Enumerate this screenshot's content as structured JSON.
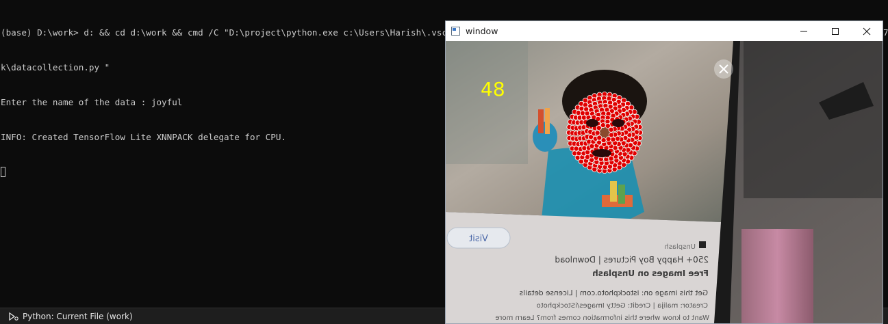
{
  "terminal": {
    "lines": [
      "(base) D:\\work> d: && cd d:\\work && cmd /C \"D:\\project\\python.exe c:\\Users\\Harish\\.vscode\\extensions\\ms-python.python-2022.6.2\\pythonFiles\\lib\\python\\debugpy\\launcher 55078 -- d:\\wor",
      "k\\datacollection.py \"",
      "Enter the name of the data : joyful",
      "INFO: Created TensorFlow Lite XNNPACK delegate for CPU."
    ]
  },
  "statusbar": {
    "icon": "debug-run-icon",
    "label": "Python: Current File (work)"
  },
  "window": {
    "title": "window",
    "frame_counter": "48",
    "counter_color": "#ffff00",
    "landmark_color": "#e00000",
    "phone_screen": {
      "source": "Unsplash",
      "visit_button": "Visit",
      "headline_1": "250+ Happy Boy Pictures | Download",
      "headline_2": "Free Images on Unsplash",
      "license_line": "Get this image on: istockphoto.com | License details",
      "creator_line": "Creator: malija | Credit: Getty Images/iStockphoto",
      "learn_line": "Want to know where this information comes from? Learn more"
    }
  }
}
